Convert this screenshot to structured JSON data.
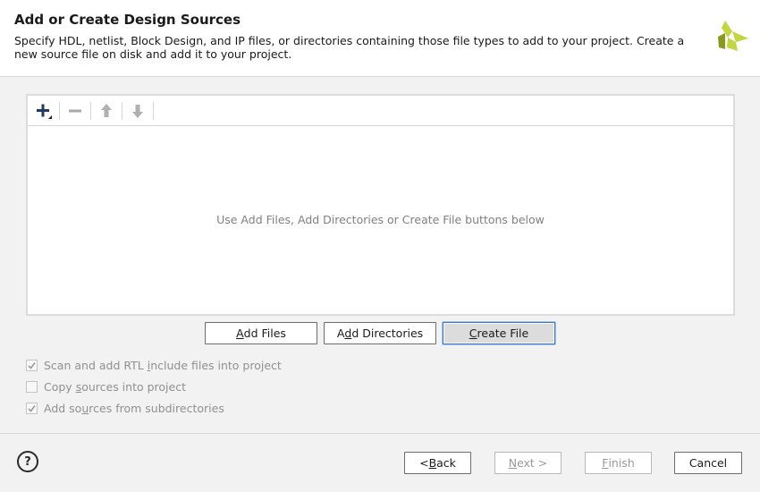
{
  "header": {
    "title": "Add or Create Design Sources",
    "description": "Specify HDL, netlist, Block Design, and IP files, or directories containing those file types to add to your project. Create a new source file on disk and add it to your project."
  },
  "toolbar": {
    "icons": [
      "add-icon",
      "remove-icon",
      "move-up-icon",
      "move-down-icon"
    ]
  },
  "file_list": {
    "empty_message": "Use Add Files, Add Directories or Create File buttons below"
  },
  "actions": {
    "add_files": {
      "mnemonic": "A",
      "rest": "dd Files"
    },
    "add_directories": {
      "pre": "A",
      "mnemonic": "d",
      "rest": "d Directories"
    },
    "create_file": {
      "mnemonic": "C",
      "rest": "reate File"
    }
  },
  "options": [
    {
      "pre": "Scan and add RTL ",
      "mnemonic": "i",
      "post": "nclude files into project",
      "checked": true
    },
    {
      "pre": "Copy ",
      "mnemonic": "s",
      "post": "ources into project",
      "checked": false
    },
    {
      "pre": "Add so",
      "mnemonic": "u",
      "post": "rces from subdirectories",
      "checked": true
    }
  ],
  "footer": {
    "help": "?",
    "back": {
      "pre": "< ",
      "mnemonic": "B",
      "post": "ack"
    },
    "next": {
      "mnemonic": "N",
      "post": "ext >"
    },
    "finish": {
      "mnemonic": "F",
      "post": "inish"
    },
    "cancel": "Cancel"
  },
  "colors": {
    "accent": "#3c74c9",
    "logo_light": "#c3d640",
    "logo_dark": "#8a9a1e"
  }
}
